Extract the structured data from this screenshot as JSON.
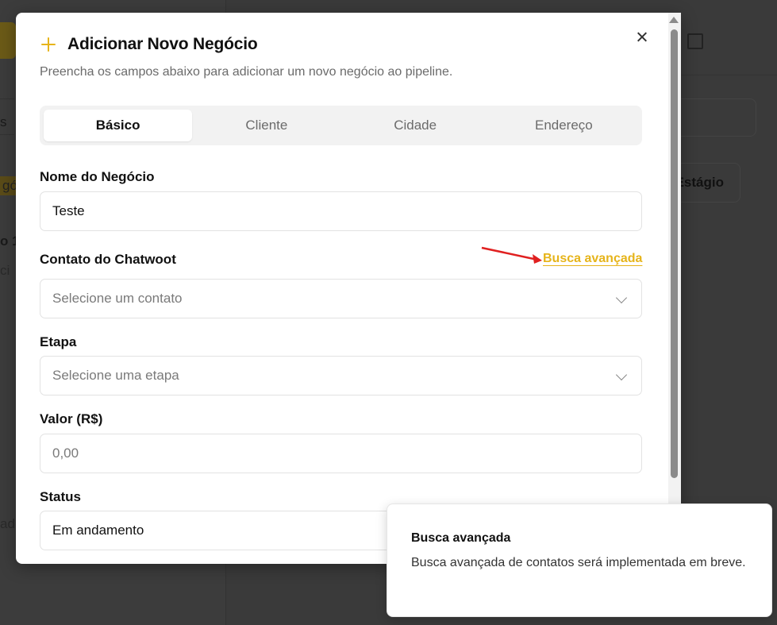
{
  "background": {
    "stage_button_label": "Estágio",
    "fragments": [
      "s",
      "gó",
      "o 1",
      "ci",
      "ad"
    ]
  },
  "modal": {
    "title": "Adicionar Novo Negócio",
    "subtitle": "Preencha os campos abaixo para adicionar um novo negócio ao pipeline.",
    "tabs": [
      {
        "label": "Básico",
        "active": true
      },
      {
        "label": "Cliente",
        "active": false
      },
      {
        "label": "Cidade",
        "active": false
      },
      {
        "label": "Endereço",
        "active": false
      }
    ],
    "fields": {
      "name": {
        "label": "Nome do Negócio",
        "value": "Teste"
      },
      "contact": {
        "label": "Contato do Chatwoot",
        "placeholder": "Selecione um contato",
        "advanced_link": "Busca avançada"
      },
      "stage": {
        "label": "Etapa",
        "placeholder": "Selecione uma etapa"
      },
      "value": {
        "label": "Valor (R$)",
        "placeholder": "0,00"
      },
      "status": {
        "label": "Status",
        "value": "Em andamento"
      }
    }
  },
  "toast": {
    "title": "Busca avançada",
    "description": "Busca avançada de contatos será implementada em breve."
  },
  "colors": {
    "accent": "#e6b41a",
    "annotation_arrow": "#e02020"
  }
}
